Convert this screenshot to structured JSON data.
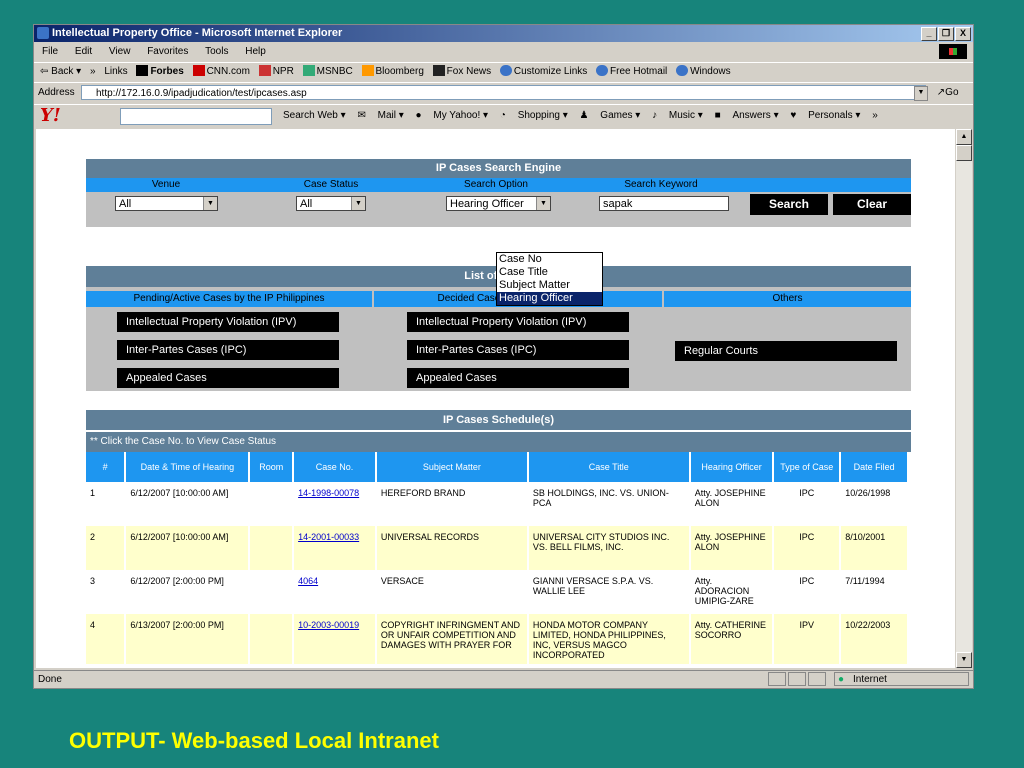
{
  "window": {
    "title": "Intellectual Property Office - Microsoft Internet Explorer",
    "controls": [
      "_",
      "❐",
      "X"
    ]
  },
  "menu": [
    "File",
    "Edit",
    "View",
    "Favorites",
    "Tools",
    "Help"
  ],
  "links_bar": {
    "back": "⇦ Back ▾",
    "chevron": "»",
    "items": [
      "Links",
      "Forbes",
      "CNN.com",
      "NPR",
      "MSNBC",
      "Bloomberg",
      "Fox News",
      "Customize Links",
      "Free Hotmail",
      "Windows"
    ]
  },
  "address": {
    "label": "Address",
    "url": "http://172.16.0.9/ipadjudication/test/ipcases.asp",
    "go": "Go"
  },
  "yahoo_bar": {
    "logo": "Y!",
    "search_button": "Search Web",
    "items": [
      "Mail",
      "My Yahoo!",
      "Shopping",
      "Games",
      "Music",
      "Answers",
      "Personals"
    ],
    "more": "»"
  },
  "search_engine": {
    "title": "IP Cases Search Engine",
    "labels": {
      "venue": "Venue",
      "case_status": "Case Status",
      "search_option": "Search Option",
      "search_keyword": "Search Keyword"
    },
    "venue_value": "All",
    "case_status_value": "All",
    "search_option_value": "Hearing Officer",
    "keyword_value": "sapak",
    "search_button": "Search",
    "clear_button": "Clear",
    "dropdown_options": [
      "Case No",
      "Case Title",
      "Subject Matter",
      "Hearing Officer"
    ]
  },
  "list_of_cases": {
    "title": "List of Cases",
    "columns": {
      "pending": "Pending/Active Cases by the IP Philippines",
      "decided": "Decided Cases by the IP Philippines",
      "others": "Others"
    },
    "pending_buttons": [
      "Intellectual Property Violation (IPV)",
      "Inter-Partes Cases (IPC)",
      "Appealed Cases"
    ],
    "decided_buttons": [
      "Intellectual Property Violation (IPV)",
      "Inter-Partes Cases (IPC)",
      "Appealed Cases"
    ],
    "others_buttons": [
      "Regular Courts"
    ]
  },
  "schedule": {
    "title": "IP Cases Schedule(s)",
    "note": "** Click the Case No. to View Case Status",
    "headers": [
      "#",
      "Date & Time of Hearing",
      "Room",
      "Case No.",
      "Subject Matter",
      "Case Title",
      "Hearing Officer",
      "Type of Case",
      "Date Filed"
    ],
    "rows": [
      {
        "num": "1",
        "datetime": "6/12/2007 [10:00:00 AM]",
        "room": "",
        "case_no": "14-1998-00078",
        "subject": "HEREFORD BRAND",
        "title": "SB HOLDINGS, INC. VS. UNION-PCA",
        "officer": "Atty. JOSEPHINE ALON",
        "type": "IPC",
        "filed": "10/26/1998"
      },
      {
        "num": "2",
        "datetime": "6/12/2007 [10:00:00 AM]",
        "room": "",
        "case_no": "14-2001-00033",
        "subject": "UNIVERSAL RECORDS",
        "title": "UNIVERSAL CITY STUDIOS INC. VS. BELL FILMS, INC.",
        "officer": "Atty. JOSEPHINE ALON",
        "type": "IPC",
        "filed": "8/10/2001"
      },
      {
        "num": "3",
        "datetime": "6/12/2007 [2:00:00 PM]",
        "room": "",
        "case_no": "4064",
        "subject": "VERSACE",
        "title": "GIANNI VERSACE S.P.A. VS. WALLIE LEE",
        "officer": "Atty. ADORACION UMIPIG-ZARE",
        "type": "IPC",
        "filed": "7/11/1994"
      },
      {
        "num": "4",
        "datetime": "6/13/2007 [2:00:00 PM]",
        "room": "",
        "case_no": "10-2003-00019",
        "subject": "COPYRIGHT INFRINGMENT AND OR UNFAIR COMPETITION AND DAMAGES WITH PRAYER FOR",
        "title": "HONDA MOTOR COMPANY LIMITED, HONDA PHILIPPINES, INC, VERSUS MAGCO INCORPORATED",
        "officer": "Atty. CATHERINE SOCORRO",
        "type": "IPV",
        "filed": "10/22/2003"
      }
    ]
  },
  "status_bar": {
    "status": "Done",
    "zone": "Internet"
  },
  "caption": "OUTPUT- Web-based Local Intranet"
}
